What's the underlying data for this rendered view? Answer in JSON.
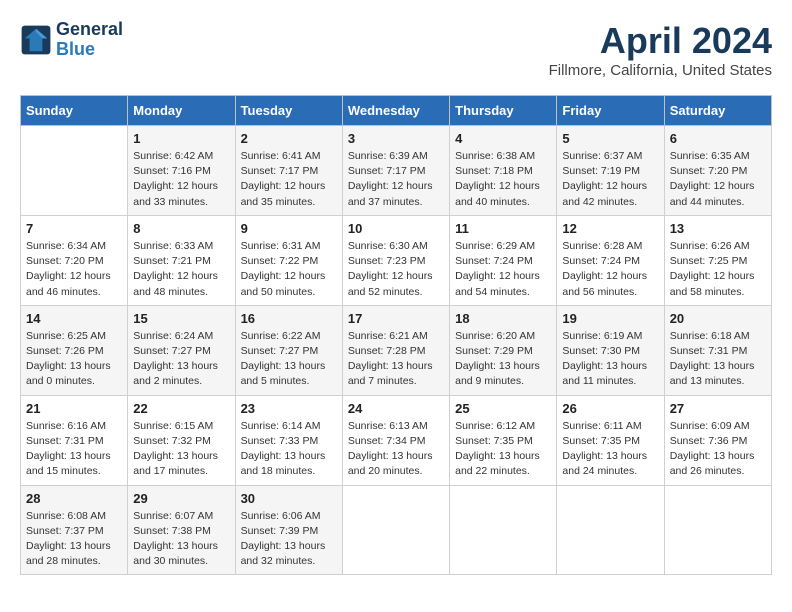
{
  "header": {
    "logo_line1": "General",
    "logo_line2": "Blue",
    "month_title": "April 2024",
    "location": "Fillmore, California, United States"
  },
  "weekdays": [
    "Sunday",
    "Monday",
    "Tuesday",
    "Wednesday",
    "Thursday",
    "Friday",
    "Saturday"
  ],
  "weeks": [
    [
      {
        "day": "",
        "info": ""
      },
      {
        "day": "1",
        "info": "Sunrise: 6:42 AM\nSunset: 7:16 PM\nDaylight: 12 hours\nand 33 minutes."
      },
      {
        "day": "2",
        "info": "Sunrise: 6:41 AM\nSunset: 7:17 PM\nDaylight: 12 hours\nand 35 minutes."
      },
      {
        "day": "3",
        "info": "Sunrise: 6:39 AM\nSunset: 7:17 PM\nDaylight: 12 hours\nand 37 minutes."
      },
      {
        "day": "4",
        "info": "Sunrise: 6:38 AM\nSunset: 7:18 PM\nDaylight: 12 hours\nand 40 minutes."
      },
      {
        "day": "5",
        "info": "Sunrise: 6:37 AM\nSunset: 7:19 PM\nDaylight: 12 hours\nand 42 minutes."
      },
      {
        "day": "6",
        "info": "Sunrise: 6:35 AM\nSunset: 7:20 PM\nDaylight: 12 hours\nand 44 minutes."
      }
    ],
    [
      {
        "day": "7",
        "info": "Sunrise: 6:34 AM\nSunset: 7:20 PM\nDaylight: 12 hours\nand 46 minutes."
      },
      {
        "day": "8",
        "info": "Sunrise: 6:33 AM\nSunset: 7:21 PM\nDaylight: 12 hours\nand 48 minutes."
      },
      {
        "day": "9",
        "info": "Sunrise: 6:31 AM\nSunset: 7:22 PM\nDaylight: 12 hours\nand 50 minutes."
      },
      {
        "day": "10",
        "info": "Sunrise: 6:30 AM\nSunset: 7:23 PM\nDaylight: 12 hours\nand 52 minutes."
      },
      {
        "day": "11",
        "info": "Sunrise: 6:29 AM\nSunset: 7:24 PM\nDaylight: 12 hours\nand 54 minutes."
      },
      {
        "day": "12",
        "info": "Sunrise: 6:28 AM\nSunset: 7:24 PM\nDaylight: 12 hours\nand 56 minutes."
      },
      {
        "day": "13",
        "info": "Sunrise: 6:26 AM\nSunset: 7:25 PM\nDaylight: 12 hours\nand 58 minutes."
      }
    ],
    [
      {
        "day": "14",
        "info": "Sunrise: 6:25 AM\nSunset: 7:26 PM\nDaylight: 13 hours\nand 0 minutes."
      },
      {
        "day": "15",
        "info": "Sunrise: 6:24 AM\nSunset: 7:27 PM\nDaylight: 13 hours\nand 2 minutes."
      },
      {
        "day": "16",
        "info": "Sunrise: 6:22 AM\nSunset: 7:27 PM\nDaylight: 13 hours\nand 5 minutes."
      },
      {
        "day": "17",
        "info": "Sunrise: 6:21 AM\nSunset: 7:28 PM\nDaylight: 13 hours\nand 7 minutes."
      },
      {
        "day": "18",
        "info": "Sunrise: 6:20 AM\nSunset: 7:29 PM\nDaylight: 13 hours\nand 9 minutes."
      },
      {
        "day": "19",
        "info": "Sunrise: 6:19 AM\nSunset: 7:30 PM\nDaylight: 13 hours\nand 11 minutes."
      },
      {
        "day": "20",
        "info": "Sunrise: 6:18 AM\nSunset: 7:31 PM\nDaylight: 13 hours\nand 13 minutes."
      }
    ],
    [
      {
        "day": "21",
        "info": "Sunrise: 6:16 AM\nSunset: 7:31 PM\nDaylight: 13 hours\nand 15 minutes."
      },
      {
        "day": "22",
        "info": "Sunrise: 6:15 AM\nSunset: 7:32 PM\nDaylight: 13 hours\nand 17 minutes."
      },
      {
        "day": "23",
        "info": "Sunrise: 6:14 AM\nSunset: 7:33 PM\nDaylight: 13 hours\nand 18 minutes."
      },
      {
        "day": "24",
        "info": "Sunrise: 6:13 AM\nSunset: 7:34 PM\nDaylight: 13 hours\nand 20 minutes."
      },
      {
        "day": "25",
        "info": "Sunrise: 6:12 AM\nSunset: 7:35 PM\nDaylight: 13 hours\nand 22 minutes."
      },
      {
        "day": "26",
        "info": "Sunrise: 6:11 AM\nSunset: 7:35 PM\nDaylight: 13 hours\nand 24 minutes."
      },
      {
        "day": "27",
        "info": "Sunrise: 6:09 AM\nSunset: 7:36 PM\nDaylight: 13 hours\nand 26 minutes."
      }
    ],
    [
      {
        "day": "28",
        "info": "Sunrise: 6:08 AM\nSunset: 7:37 PM\nDaylight: 13 hours\nand 28 minutes."
      },
      {
        "day": "29",
        "info": "Sunrise: 6:07 AM\nSunset: 7:38 PM\nDaylight: 13 hours\nand 30 minutes."
      },
      {
        "day": "30",
        "info": "Sunrise: 6:06 AM\nSunset: 7:39 PM\nDaylight: 13 hours\nand 32 minutes."
      },
      {
        "day": "",
        "info": ""
      },
      {
        "day": "",
        "info": ""
      },
      {
        "day": "",
        "info": ""
      },
      {
        "day": "",
        "info": ""
      }
    ]
  ]
}
